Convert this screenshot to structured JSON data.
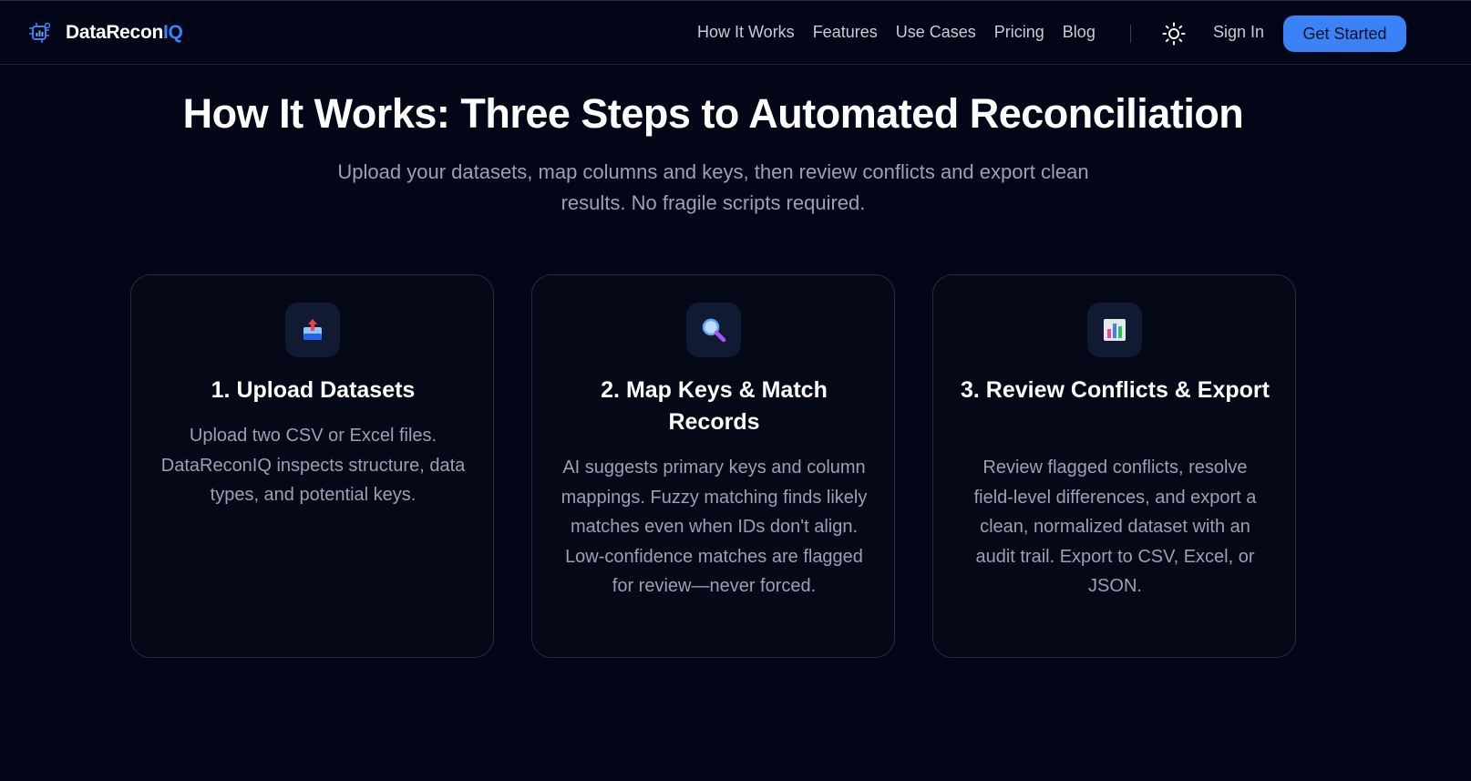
{
  "header": {
    "logo_main": "DataRecon",
    "logo_accent": "IQ",
    "nav": [
      {
        "label": "How It Works"
      },
      {
        "label": "Features"
      },
      {
        "label": "Use Cases"
      },
      {
        "label": "Pricing"
      },
      {
        "label": "Blog"
      }
    ],
    "theme_icon": "sun-icon",
    "sign_in_label": "Sign In",
    "get_started_label": "Get Started",
    "accent_color": "#3b82f6"
  },
  "hero": {
    "title": "How It Works: Three Steps to Automated Reconciliation",
    "subtitle": "Upload your datasets, map columns and keys, then review conflicts and export clean results. No fragile scripts required."
  },
  "steps": [
    {
      "icon": "upload-tray-icon",
      "title": "1. Upload Datasets",
      "body": "Upload two CSV or Excel files. DataReconIQ inspects structure, data types, and potential keys."
    },
    {
      "icon": "magnifier-icon",
      "title": "2. Map Keys & Match Records",
      "body": "AI suggests primary keys and column mappings. Fuzzy matching finds likely matches even when IDs don't align. Low-confidence matches are flagged for review—never forced."
    },
    {
      "icon": "bar-chart-icon",
      "title": "3. Review Conflicts & Export",
      "body": "Review flagged conflicts, resolve field-level differences, and export a clean, normalized dataset with an audit trail. Export to CSV, Excel, or JSON."
    }
  ]
}
